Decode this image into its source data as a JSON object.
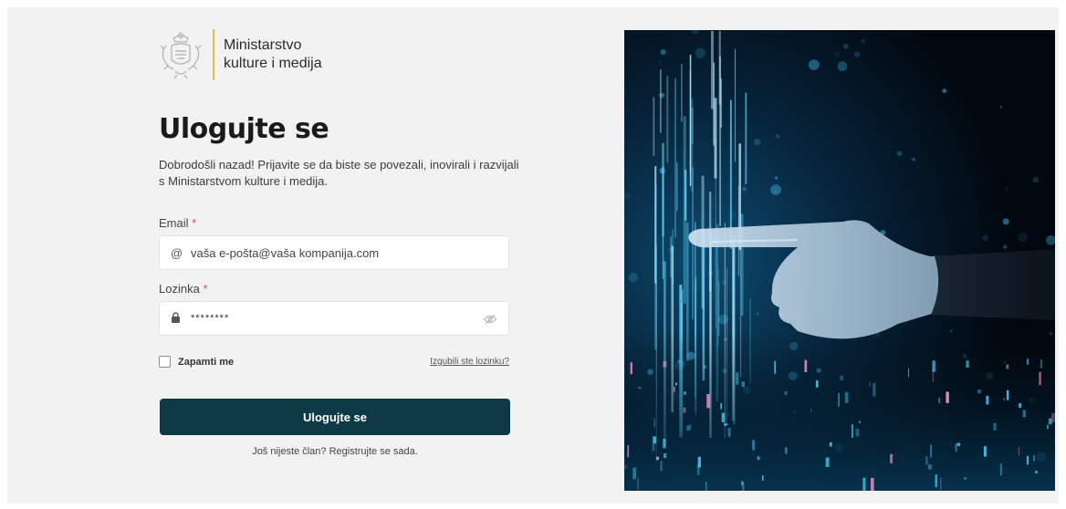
{
  "logo": {
    "line1": "Ministarstvo",
    "line2": "kulture i medija",
    "accent": "#e9b949"
  },
  "title": "Ulogujte se",
  "subtitle": "Dobrodošli nazad! Prijavite se da biste se povezali, inovirali i razvijali s Ministarstvom kulture i medija.",
  "email": {
    "label": "Email",
    "required_mark": "*",
    "icon": "@",
    "placeholder": "vaša e-pošta@vaša kompanija.com"
  },
  "password": {
    "label": "Lozinka",
    "required_mark": "*",
    "icon": "lock-icon",
    "value": "********"
  },
  "remember_label": "Zapamti me",
  "forgot_label": "Izgubili ste lozinku?",
  "login_button": "Ulogujte se",
  "register_text": "Još nijeste član? Registrujte se sada.",
  "colors": {
    "button": "#0e3a45",
    "required": "#d9534f",
    "background": "#f2f2f2"
  }
}
